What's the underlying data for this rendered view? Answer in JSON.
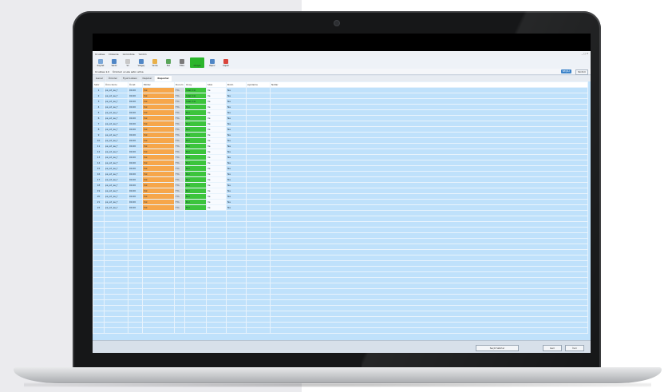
{
  "menu": {
    "items": [
      "Ucuzkes",
      "Düzenle",
      "Görüntüle",
      "Yardım"
    ],
    "window_controls": "_ □ X"
  },
  "toolbar": {
    "buttons": [
      {
        "label": "Kaydet",
        "icon": "save-icon",
        "color": "#7aa7d8"
      },
      {
        "label": "Yazdır",
        "icon": "print-icon",
        "color": "#4f86c6"
      },
      {
        "label": "Sil",
        "icon": "delete-icon",
        "color": "#c8c8c8"
      },
      {
        "label": "Vazgeç",
        "icon": "undo-icon",
        "color": "#4f86c6"
      },
      {
        "label": "Yenile",
        "icon": "refresh-icon",
        "color": "#e8b04a"
      },
      {
        "label": "Bul",
        "icon": "search-icon",
        "color": "#5aa55a"
      },
      {
        "label": "Filtre",
        "icon": "filter-icon",
        "color": "#7a7a7a"
      },
      {
        "label": "Onayla",
        "icon": "check-icon",
        "color": "#2bb52b"
      },
      {
        "label": "Rapor",
        "icon": "report-icon",
        "color": "#4f86c6"
      },
      {
        "label": "Kapat",
        "icon": "close-icon",
        "color": "#d9443a"
      }
    ]
  },
  "info": {
    "left": "Ucuzkes 1.0",
    "right": "Ürünleri ucuza satın alma",
    "pill": "SEÇİLİ",
    "pill2": "Yardım"
  },
  "tabs": [
    "Genel",
    "Ürünler",
    "Fiyat Listesi",
    "Depolar",
    "Raporlar"
  ],
  "active_tab": "Raporlar",
  "grid": {
    "headers": [
      "Satır",
      "Ürün Kodu",
      "Ücret",
      "Miktar",
      "Durum",
      "Onay",
      "Stok",
      "Birim",
      "Açıklama",
      "Notlar"
    ],
    "rows": [
      [
        "1",
        "pa_xd_as_f",
        "00.00",
        "Yok",
        "Tm",
        "Sdak Ciz",
        "Ve",
        "Na"
      ],
      [
        "2",
        "pa_xd_as_f",
        "00.00",
        "Yok",
        "Tm",
        "Sdak Ciz",
        "Ve",
        "Na"
      ],
      [
        "3",
        "pa_xd_as_f",
        "00.00",
        "Yok",
        "Tm",
        "Sdak Ciz",
        "Ve",
        "Na"
      ],
      [
        "4",
        "pa_xd_as_f",
        "00.00",
        "Yok",
        "Tm",
        "Bul",
        "Ve",
        "Na"
      ],
      [
        "5",
        "pa_xd_as_f",
        "00.00",
        "Yok",
        "Tm",
        "Bul",
        "Ve",
        "Na"
      ],
      [
        "6",
        "pa_xd_as_f",
        "00.00",
        "Yok",
        "Tm",
        "Bul",
        "Ve",
        "Na"
      ],
      [
        "7",
        "pa_xd_as_f",
        "00.00",
        "Yok",
        "Tm",
        "Bul",
        "Ve",
        "Na"
      ],
      [
        "8",
        "pa_xd_as_f",
        "00.00",
        "Yok",
        "Tm",
        "Bul",
        "Ve",
        "Na"
      ],
      [
        "9",
        "pa_xd_as_f",
        "00.00",
        "Yok",
        "Tm",
        "Bul",
        "Ve",
        "Na"
      ],
      [
        "10",
        "pa_xd_as_f",
        "00.00",
        "Yok",
        "Tm",
        "Bul",
        "Ve",
        "Na"
      ],
      [
        "11",
        "pa_xd_as_f",
        "00.00",
        "Yok",
        "Tm",
        "Bul",
        "Ve",
        "Na"
      ],
      [
        "12",
        "pa_xd_as_f",
        "00.00",
        "Yok",
        "Tm",
        "Bul",
        "Ve",
        "Na"
      ],
      [
        "13",
        "pa_xd_as_f",
        "00.00",
        "Yok",
        "Tm",
        "Bul",
        "Ve",
        "Na"
      ],
      [
        "14",
        "pa_xd_as_f",
        "00.00",
        "Yok",
        "Tm",
        "Bul",
        "Ve",
        "Na"
      ],
      [
        "15",
        "pa_xd_as_f",
        "00.00",
        "Yok",
        "Tm",
        "Bul",
        "Ve",
        "Na"
      ],
      [
        "16",
        "pa_xd_as_f",
        "00.00",
        "Yok",
        "Tm",
        "Bul",
        "Ve",
        "Na"
      ],
      [
        "17",
        "pa_xd_as_f",
        "00.00",
        "Yok",
        "Tm",
        "Bul",
        "Ve",
        "Na"
      ],
      [
        "18",
        "pa_xd_as_f",
        "00.00",
        "Yok",
        "Tm",
        "Bul",
        "Ve",
        "Na"
      ],
      [
        "19",
        "pa_xd_as_f",
        "00.00",
        "Yok",
        "Tm",
        "Bul",
        "Ve",
        "Na"
      ],
      [
        "20",
        "pa_xd_as_f",
        "00.00",
        "Yok",
        "Tm",
        "Bul",
        "Ve",
        "Na"
      ],
      [
        "21",
        "pa_xd_as_f",
        "00.00",
        "Yok",
        "Tm",
        "Bul",
        "Ve",
        "Na"
      ],
      [
        "22",
        "pa_xd_as_f",
        "00.00",
        "Yok",
        "Tm",
        "Bul",
        "Ve",
        "Na"
      ]
    ]
  },
  "status": {
    "btn1": "Seçili Satırlar",
    "btn2": "Geri",
    "btn3": "İleri"
  },
  "colors": {
    "grid_bg": "#bfe1fb",
    "orange": "#f6a64a",
    "green": "#3cc43c",
    "bezel": "#161718"
  }
}
